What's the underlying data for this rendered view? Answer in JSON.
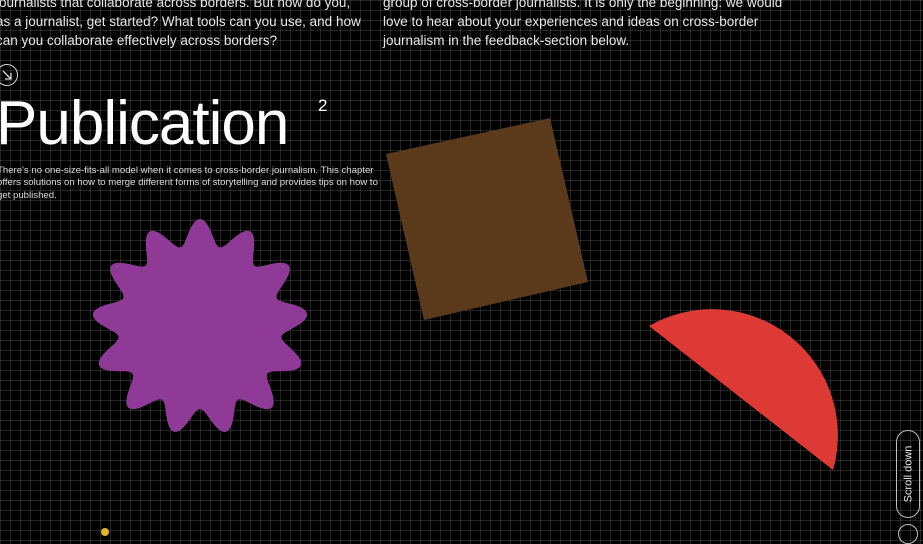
{
  "intro": {
    "left_text": "journalists that collaborate across borders. But how do you, as a journalist, get started? What tools can you use, and how can you collaborate effectively across borders?",
    "right_text": "group of cross-border journalists. It is only the beginning: we would love to hear about your experiences and ideas on cross-border journalism in the feedback-section below."
  },
  "chapter": {
    "arrow_icon": "arrow-down-right-icon",
    "title": "Publication",
    "number": "2",
    "description": "There's no one-size-fits-all model when it comes to cross-border journalism. This chapter offers solutions on how to merge different forms of storytelling and provides tips on how to get published."
  },
  "shapes": {
    "star_color": "#8e3a96",
    "square_color": "#5b3a1b",
    "semicircle_color": "#de3a35"
  },
  "scroll": {
    "label": "Scroll down"
  },
  "theme": {
    "background": "#000000",
    "grid": "rgba(255,255,255,0.14)"
  }
}
